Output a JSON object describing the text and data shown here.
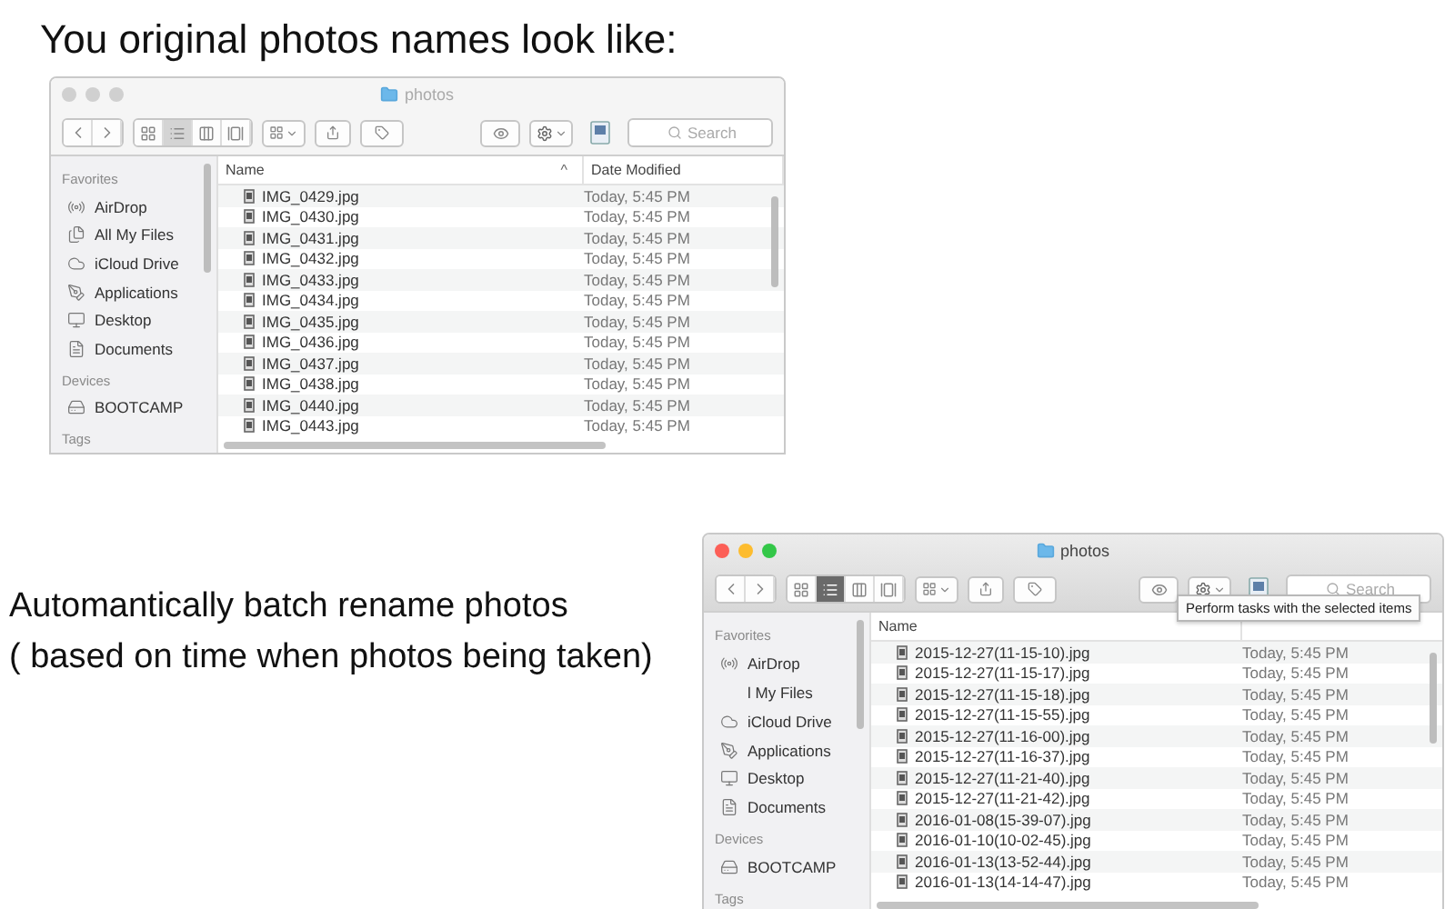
{
  "heading": "You original photos names look like:",
  "window_1": {
    "title": "photos",
    "active": false,
    "search": {
      "placeholder": "Search"
    },
    "views": [
      {
        "selected": false
      },
      {
        "selected": true
      },
      {
        "selected": false
      },
      {
        "selected": false
      }
    ],
    "sidebar": [
      {
        "kind": "header",
        "label": "Favorites"
      },
      {
        "kind": "airdrop",
        "label": "AirDrop"
      },
      {
        "kind": "files",
        "label": "All My Files"
      },
      {
        "kind": "cloud",
        "label": "iCloud Drive"
      },
      {
        "kind": "apps",
        "label": "Applications"
      },
      {
        "kind": "desktop",
        "label": "Desktop"
      },
      {
        "kind": "documents",
        "label": "Documents"
      },
      {
        "kind": "header",
        "label": "Devices"
      },
      {
        "kind": "drive",
        "label": "BOOTCAMP"
      },
      {
        "kind": "header",
        "label": "Tags"
      }
    ],
    "columns": [
      "Name",
      "Date Modified"
    ],
    "sort_arrow": "^",
    "rows": [
      {
        "name": "IMG_0429.jpg",
        "date": "Today, 5:45 PM"
      },
      {
        "name": "IMG_0430.jpg",
        "date": "Today, 5:45 PM"
      },
      {
        "name": "IMG_0431.jpg",
        "date": "Today, 5:45 PM"
      },
      {
        "name": "IMG_0432.jpg",
        "date": "Today, 5:45 PM"
      },
      {
        "name": "IMG_0433.jpg",
        "date": "Today, 5:45 PM"
      },
      {
        "name": "IMG_0434.jpg",
        "date": "Today, 5:45 PM"
      },
      {
        "name": "IMG_0435.jpg",
        "date": "Today, 5:45 PM"
      },
      {
        "name": "IMG_0436.jpg",
        "date": "Today, 5:45 PM"
      },
      {
        "name": "IMG_0437.jpg",
        "date": "Today, 5:45 PM"
      },
      {
        "name": "IMG_0438.jpg",
        "date": "Today, 5:45 PM"
      },
      {
        "name": "IMG_0440.jpg",
        "date": "Today, 5:45 PM"
      },
      {
        "name": "IMG_0443.jpg",
        "date": "Today, 5:45 PM"
      }
    ]
  },
  "caption": [
    "Automantically batch rename photos",
    "( based on time when photos being taken)"
  ],
  "window_2": {
    "title": "photos",
    "active": true,
    "search": {
      "placeholder": "Search"
    },
    "views": [
      {
        "selected": false
      },
      {
        "selected": true
      },
      {
        "selected": false
      },
      {
        "selected": false
      }
    ],
    "tooltip": "Perform tasks with the selected items",
    "sidebar": [
      {
        "kind": "header",
        "label": "Favorites"
      },
      {
        "kind": "airdrop",
        "label": "AirDrop"
      },
      {
        "kind": "covered",
        "label": "l My Files"
      },
      {
        "kind": "cloud",
        "label": "iCloud Drive"
      },
      {
        "kind": "apps",
        "label": "Applications"
      },
      {
        "kind": "desktop",
        "label": "Desktop"
      },
      {
        "kind": "documents",
        "label": "Documents"
      },
      {
        "kind": "header",
        "label": "Devices"
      },
      {
        "kind": "drive",
        "label": "BOOTCAMP"
      },
      {
        "kind": "header",
        "label": "Tags"
      }
    ],
    "columns": [
      "Name"
    ],
    "rows": [
      {
        "name": "2015-12-27(11-15-10).jpg",
        "date": "Today, 5:45 PM"
      },
      {
        "name": "2015-12-27(11-15-17).jpg",
        "date": "Today, 5:45 PM"
      },
      {
        "name": "2015-12-27(11-15-18).jpg",
        "date": "Today, 5:45 PM"
      },
      {
        "name": "2015-12-27(11-15-55).jpg",
        "date": "Today, 5:45 PM"
      },
      {
        "name": "2015-12-27(11-16-00).jpg",
        "date": "Today, 5:45 PM"
      },
      {
        "name": "2015-12-27(11-16-37).jpg",
        "date": "Today, 5:45 PM"
      },
      {
        "name": "2015-12-27(11-21-40).jpg",
        "date": "Today, 5:45 PM"
      },
      {
        "name": "2015-12-27(11-21-42).jpg",
        "date": "Today, 5:45 PM"
      },
      {
        "name": "2016-01-08(15-39-07).jpg",
        "date": "Today, 5:45 PM"
      },
      {
        "name": "2016-01-10(10-02-45).jpg",
        "date": "Today, 5:45 PM"
      },
      {
        "name": "2016-01-13(13-52-44).jpg",
        "date": "Today, 5:45 PM"
      },
      {
        "name": "2016-01-13(14-14-47).jpg",
        "date": "Today, 5:45 PM"
      }
    ]
  }
}
